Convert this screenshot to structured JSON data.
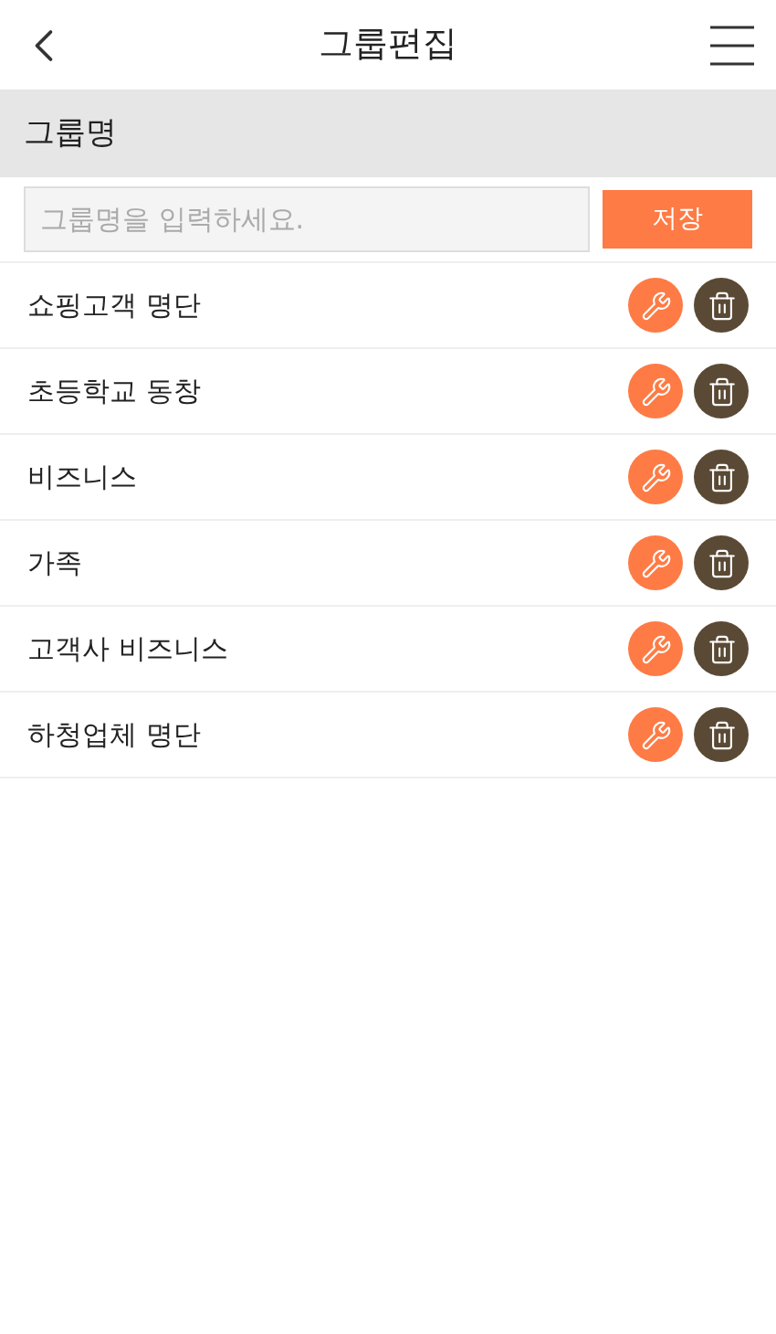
{
  "header": {
    "title": "그룹편집"
  },
  "section": {
    "title": "그룹명"
  },
  "form": {
    "placeholder": "그룹명을 입력하세요.",
    "button": "저장"
  },
  "groups": [
    {
      "name": "쇼핑고객 명단"
    },
    {
      "name": "초등학교 동창"
    },
    {
      "name": "비즈니스"
    },
    {
      "name": "가족"
    },
    {
      "name": "고객사 비즈니스"
    },
    {
      "name": "하청업체 명단"
    }
  ]
}
